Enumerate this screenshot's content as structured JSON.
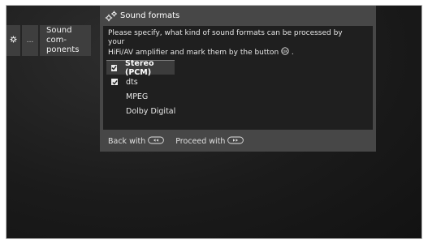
{
  "breadcrumb": {
    "more_label": "...",
    "current_label": "Sound com-\nponents"
  },
  "dialog": {
    "title": "Sound formats",
    "instruction_line1": "Please specify, what kind of sound formats can be processed by your",
    "instruction_line2": "HiFi/AV amplifier and mark them by the button",
    "instruction_end": " .",
    "options": [
      {
        "label": "Stereo (PCM)",
        "checked": true,
        "selected": true
      },
      {
        "label": "dts",
        "checked": true,
        "selected": false
      },
      {
        "label": "MPEG",
        "checked": false,
        "selected": false
      },
      {
        "label": "Dolby Digital",
        "checked": false,
        "selected": false
      }
    ]
  },
  "footer": {
    "back_label": "Back with",
    "proceed_label": "Proceed with"
  }
}
